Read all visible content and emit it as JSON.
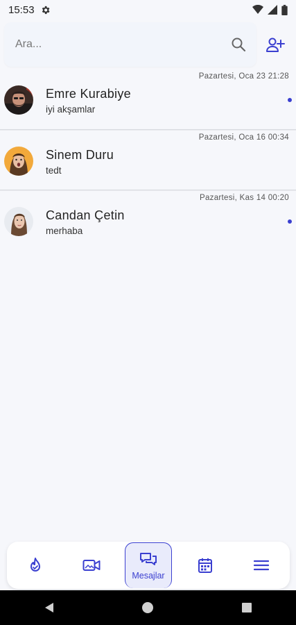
{
  "status_bar": {
    "time": "15:53"
  },
  "search": {
    "placeholder": "Ara..."
  },
  "chats": [
    {
      "name": "Emre Kurabiye",
      "preview": "iyi akşamlar",
      "time": "Pazartesi, Oca 23  21:28",
      "unread": true
    },
    {
      "name": "Sinem Duru",
      "preview": "tedt",
      "time": "Pazartesi, Oca 16  00:34",
      "unread": false
    },
    {
      "name": "Candan Çetin",
      "preview": "merhaba",
      "time": "Pazartesi, Kas 14  00:20",
      "unread": true
    }
  ],
  "bottom_nav": {
    "messages_label": "Mesajlar"
  },
  "colors": {
    "accent": "#3a3fd0",
    "background": "#f6f7fb"
  }
}
